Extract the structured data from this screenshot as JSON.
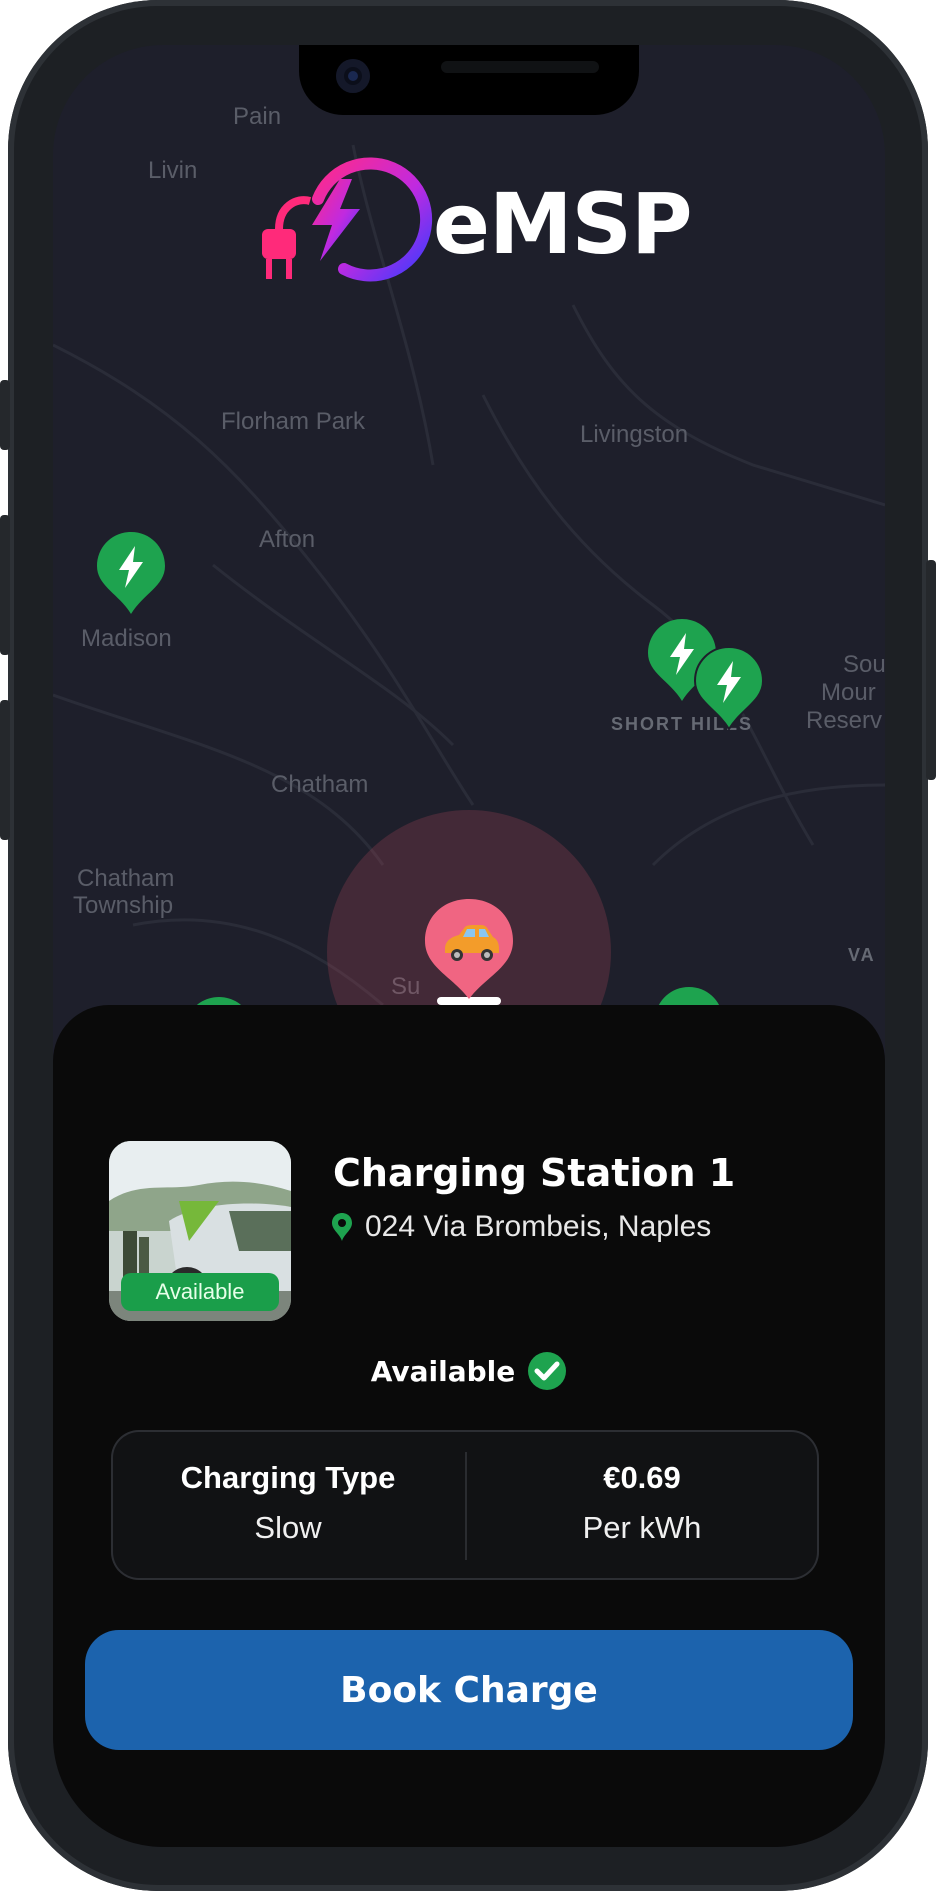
{
  "app": {
    "brand": "eMSP"
  },
  "map": {
    "labels": [
      {
        "text": "Pain",
        "key": "pain"
      },
      {
        "text": "Livin",
        "key": "livin"
      },
      {
        "text": "Florham Park",
        "key": "florham-park"
      },
      {
        "text": "Livingston",
        "key": "livingston"
      },
      {
        "text": "Afton",
        "key": "afton"
      },
      {
        "text": "Madison",
        "key": "madison"
      },
      {
        "text": "SHORT HILLS",
        "key": "short-hills"
      },
      {
        "text": "Sou",
        "key": "sou"
      },
      {
        "text": "Mour",
        "key": "mour"
      },
      {
        "text": "Reserv",
        "key": "reserv"
      },
      {
        "text": "Chatham",
        "key": "chatham"
      },
      {
        "text": "Chatham",
        "key": "chatham-township-1"
      },
      {
        "text": "Township",
        "key": "chatham-township-2"
      },
      {
        "text": "Su",
        "key": "su"
      },
      {
        "text": "VA",
        "key": "va"
      }
    ],
    "pin_color": "#1ea34f",
    "user_marker_color": "#f06582"
  },
  "station": {
    "title": "Charging Station 1",
    "address": "024 Via Brombeis, Naples",
    "thumb_badge": "Available",
    "status": "Available",
    "status_color": "#1ea34f"
  },
  "info": {
    "left_head": "Charging Type",
    "left_value": "Slow",
    "right_head": "€0.69",
    "right_value": "Per kWh"
  },
  "actions": {
    "book_label": "Book Charge",
    "book_color": "#1c63ad"
  }
}
